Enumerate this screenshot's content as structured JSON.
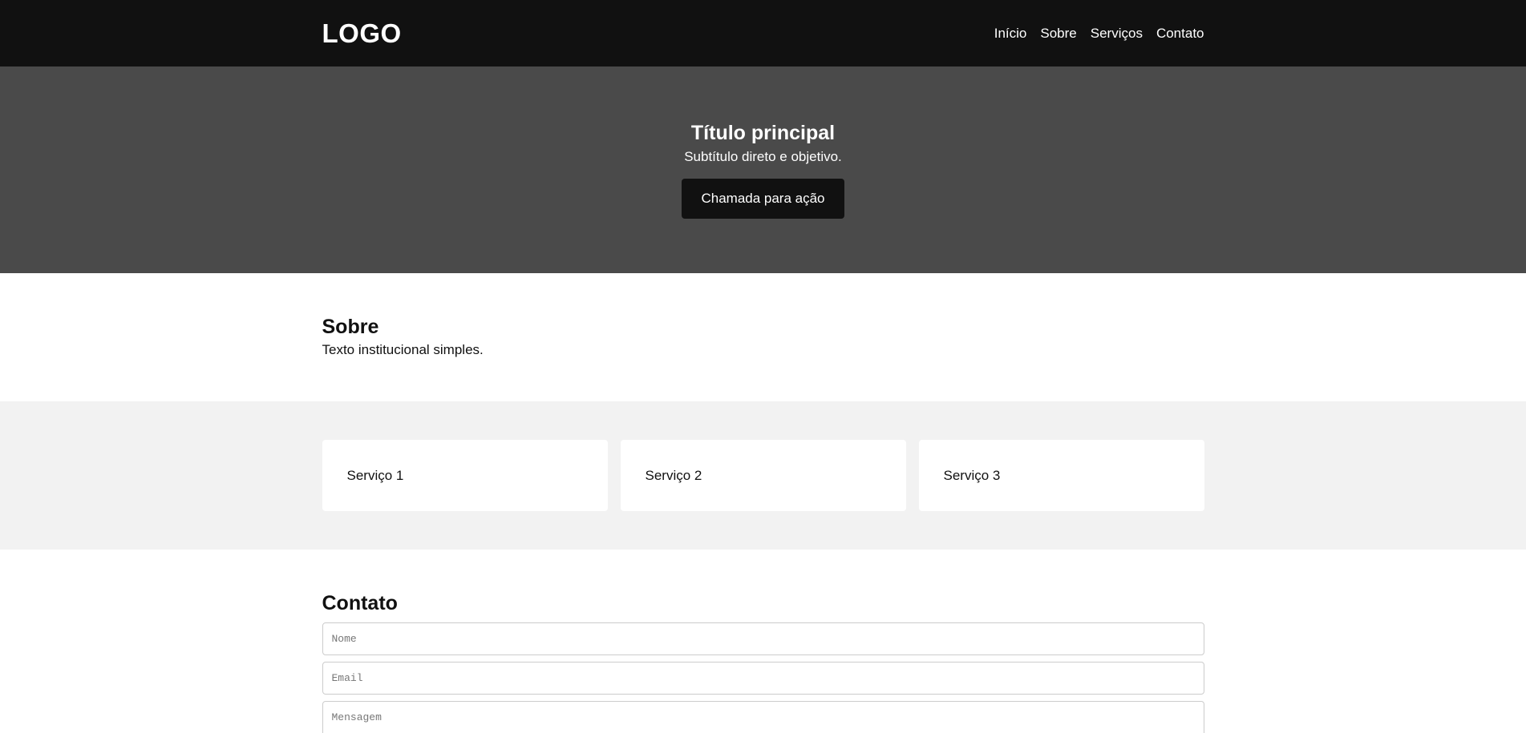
{
  "header": {
    "logo": "LOGO",
    "nav": [
      {
        "label": "Início"
      },
      {
        "label": "Sobre"
      },
      {
        "label": "Serviços"
      },
      {
        "label": "Contato"
      }
    ]
  },
  "hero": {
    "title": "Título principal",
    "subtitle": "Subtítulo direto e objetivo.",
    "cta_label": "Chamada para ação"
  },
  "about": {
    "title": "Sobre",
    "text": "Texto institucional simples."
  },
  "services": {
    "items": [
      {
        "label": "Serviço 1"
      },
      {
        "label": "Serviço 2"
      },
      {
        "label": "Serviço 3"
      }
    ]
  },
  "contact": {
    "title": "Contato",
    "fields": {
      "name_placeholder": "Nome",
      "email_placeholder": "Email",
      "message_placeholder": "Mensagem"
    }
  },
  "colors": {
    "header_bg": "#111111",
    "hero_bg": "#4a4a4a",
    "services_bg": "#f2f2f2"
  }
}
